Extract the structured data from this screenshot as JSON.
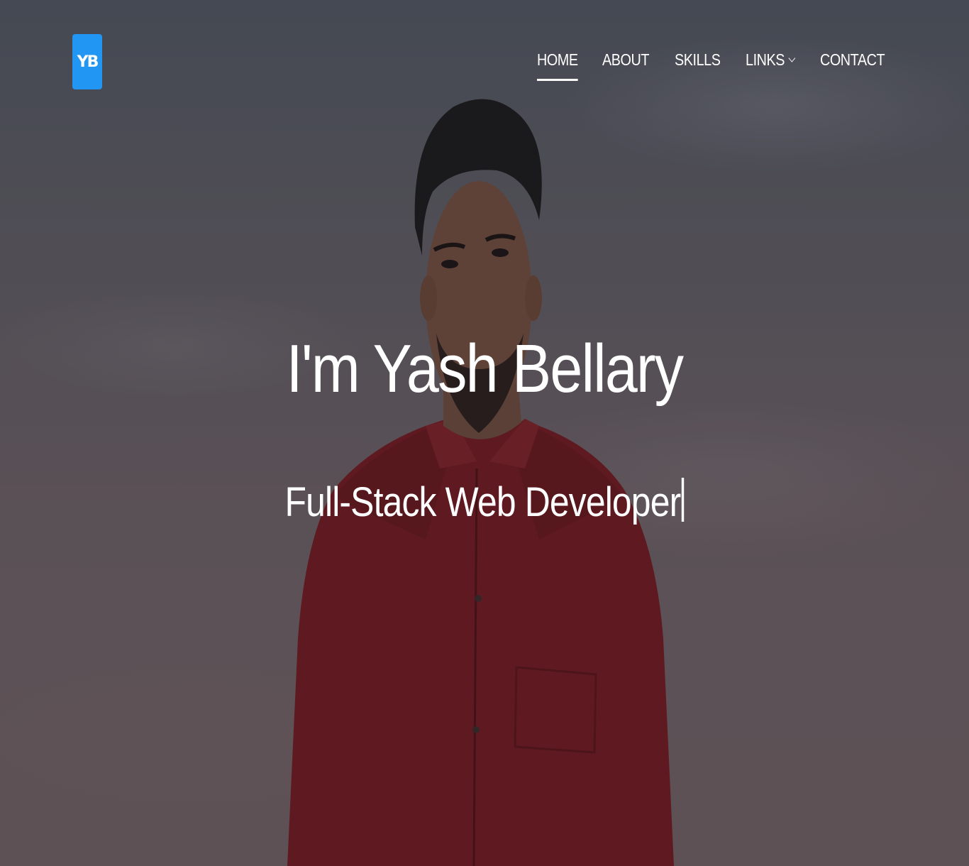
{
  "brand": {
    "logo_text": "YB",
    "accent_color": "#2196f3"
  },
  "nav": {
    "items": [
      {
        "label": "HOME",
        "active": true
      },
      {
        "label": "ABOUT",
        "active": false
      },
      {
        "label": "SKILLS",
        "active": false
      },
      {
        "label": "LINKS",
        "active": false,
        "has_dropdown": true
      },
      {
        "label": "CONTACT",
        "active": false
      }
    ]
  },
  "hero": {
    "headline": "I'm Yash Bellary",
    "subtitle": "Full-Stack Web Developer",
    "shirt_color": "#7a1f25"
  }
}
